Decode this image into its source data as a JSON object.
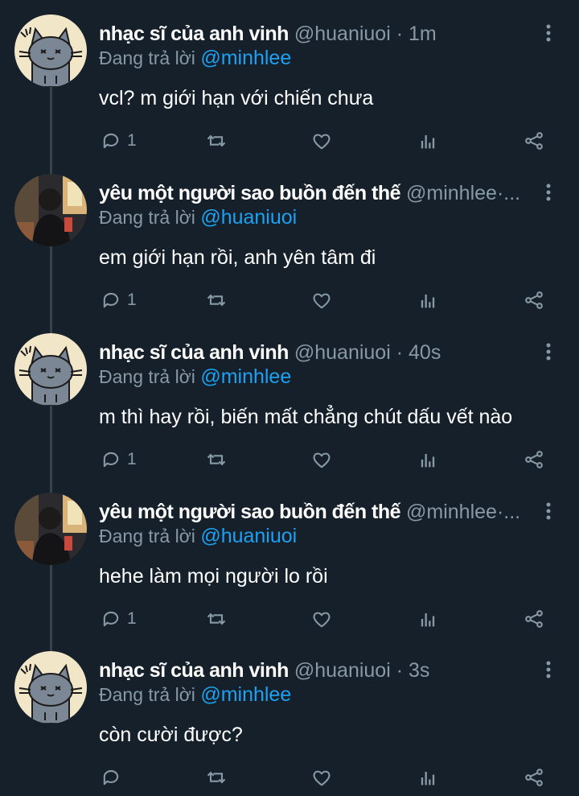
{
  "colors": {
    "background": "#15202b",
    "secondary_text": "#8899a6",
    "link": "#1da1f2",
    "thread_line": "#38444d"
  },
  "tweets": [
    {
      "avatar": "cat-avatar",
      "name": "nhạc sĩ của anh vinh",
      "handle": "@huaniuoi",
      "separator": "·",
      "time": "1m",
      "replying_label": "Đang trả lời",
      "replying_to": "@minhlee",
      "text": "vcl? m giới hạn với chiến chưa",
      "reply_count": "1"
    },
    {
      "avatar": "photo-avatar",
      "name": "yêu một người sao buồn đến thế",
      "handle": "@minhlee",
      "separator": "·...",
      "time": "",
      "replying_label": "Đang trả lời",
      "replying_to": "@huaniuoi",
      "text": "em giới hạn rồi, anh yên tâm đi",
      "reply_count": "1"
    },
    {
      "avatar": "cat-avatar",
      "name": "nhạc sĩ của anh vinh",
      "handle": "@huaniuoi",
      "separator": "·",
      "time": "40s",
      "replying_label": "Đang trả lời",
      "replying_to": "@minhlee",
      "text": "m thì hay rồi, biến mất chẳng chút dấu vết nào",
      "reply_count": "1"
    },
    {
      "avatar": "photo-avatar",
      "name": "yêu một người sao buồn đến thế",
      "handle": "@minhlee",
      "separator": "·...",
      "time": "",
      "replying_label": "Đang trả lời",
      "replying_to": "@huaniuoi",
      "text": "hehe làm mọi người lo rồi",
      "reply_count": "1"
    },
    {
      "avatar": "cat-avatar",
      "name": "nhạc sĩ của anh vinh",
      "handle": "@huaniuoi",
      "separator": "·",
      "time": "3s",
      "replying_label": "Đang trả lời",
      "replying_to": "@minhlee",
      "text": "còn cười được?",
      "reply_count": ""
    }
  ],
  "action_icons": [
    "reply-icon",
    "retweet-icon",
    "like-icon",
    "analytics-icon",
    "share-icon"
  ]
}
